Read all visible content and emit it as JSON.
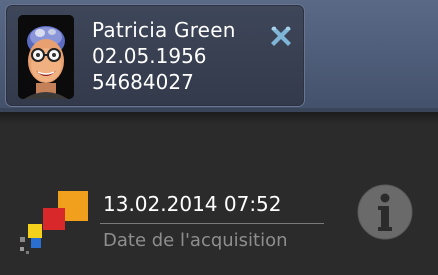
{
  "patient": {
    "name": "Patricia  Green",
    "birth_date": "02.05.1956",
    "id": "54684027",
    "avatar_icon": "patient-avatar-image",
    "close_icon": "close-icon"
  },
  "acquisition": {
    "datetime": "13.02.2014 07:52",
    "label": "Date de l'acquisition",
    "logo_icon": "acquisition-logo-icon",
    "info_icon": "info-icon"
  },
  "colors": {
    "header_band": "#4d5c78",
    "background": "#2b2b2b",
    "close_icon": "#7fb6d8",
    "info_icon": "#6a6a6a",
    "logo_orange": "#f0a01c",
    "logo_red": "#d8282a",
    "logo_yellow": "#f4d21c",
    "logo_blue": "#2a6fd0"
  }
}
